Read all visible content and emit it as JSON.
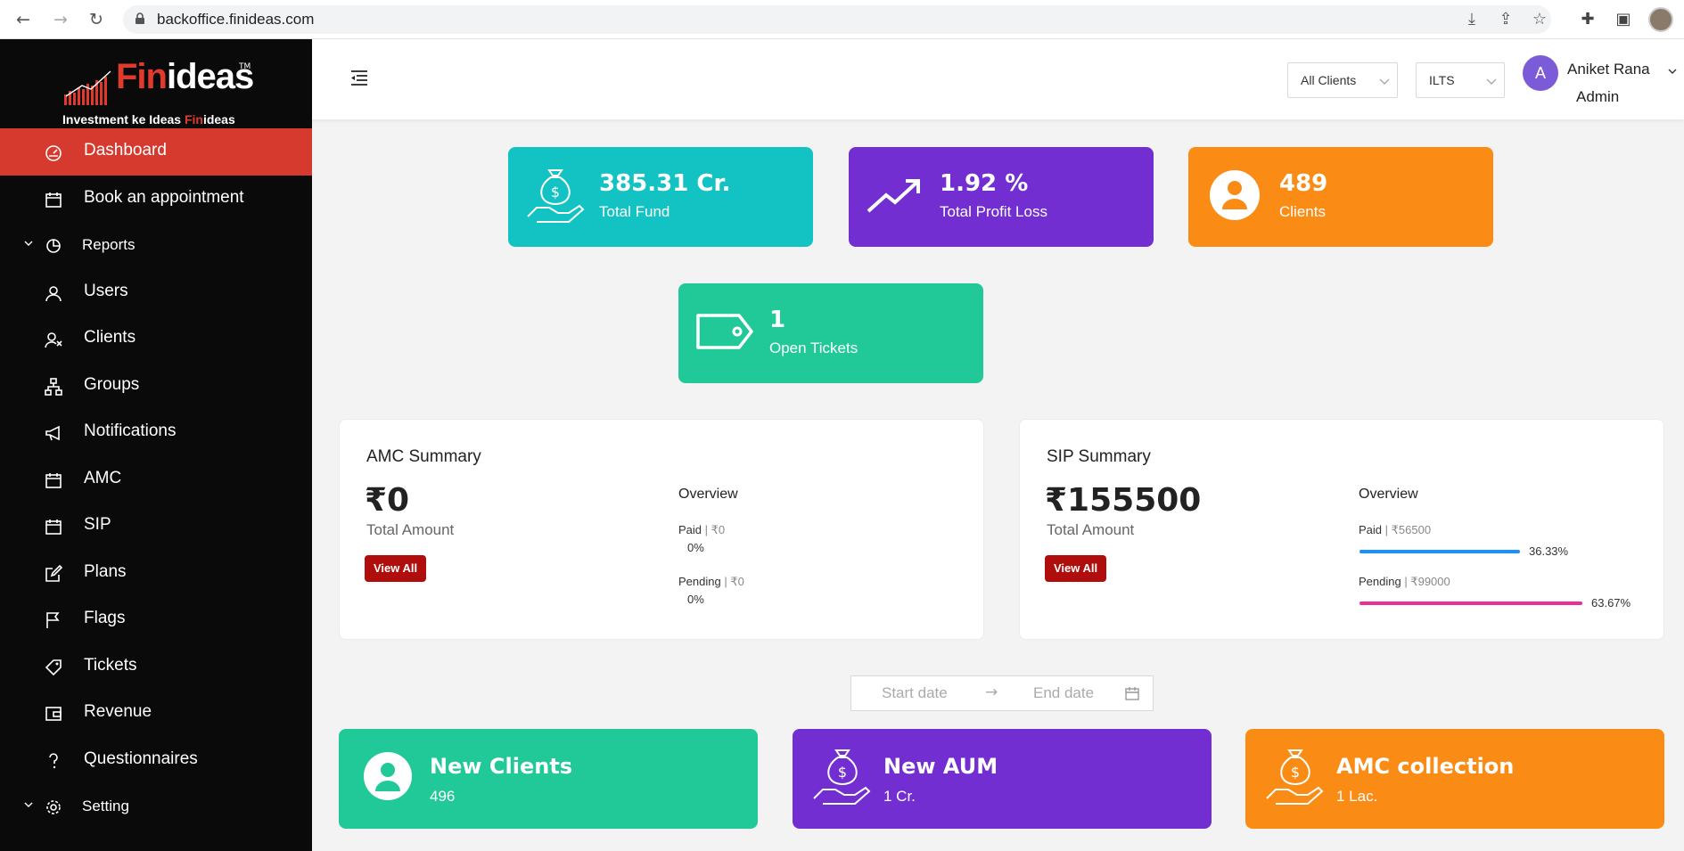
{
  "browser": {
    "url": "backoffice.finideas.com",
    "nav_icons": [
      "back-arrow-icon",
      "forward-arrow-icon",
      "reload-icon"
    ],
    "url_actions": [
      "install-icon",
      "share-icon",
      "star-icon"
    ],
    "extensions": [
      "puzzle-icon",
      "sidepanel-icon",
      "profile-avatar"
    ]
  },
  "sidebar": {
    "logo": {
      "brand_fin": "Fin",
      "brand_ideas": "ideas",
      "tagline_part1": "Investment ke Ideas ",
      "tagline_hl": "Fin",
      "tagline_part2": "ideas",
      "trademark": "TM"
    },
    "items": [
      {
        "label": "Dashboard",
        "icon": "dashboard-icon",
        "active": true
      },
      {
        "label": "Book an appointment",
        "icon": "calendar-icon"
      },
      {
        "label": "Reports",
        "icon": "pie-chart-icon",
        "group": true
      },
      {
        "label": "Users",
        "icon": "user-icon"
      },
      {
        "label": "Clients",
        "icon": "clients-icon"
      },
      {
        "label": "Groups",
        "icon": "groups-icon"
      },
      {
        "label": "Notifications",
        "icon": "megaphone-icon"
      },
      {
        "label": "AMC",
        "icon": "calendar-icon"
      },
      {
        "label": "SIP",
        "icon": "calendar-icon"
      },
      {
        "label": "Plans",
        "icon": "edit-icon"
      },
      {
        "label": "Flags",
        "icon": "flag-icon"
      },
      {
        "label": "Tickets",
        "icon": "tag-icon"
      },
      {
        "label": "Revenue",
        "icon": "wallet-icon"
      },
      {
        "label": "Questionnaires",
        "icon": "question-icon"
      },
      {
        "label": "Setting",
        "icon": "gear-icon",
        "group": true
      }
    ]
  },
  "topbar": {
    "client_filter": "All Clients",
    "company_filter": "ILTS",
    "avatar_letter": "A",
    "user_name": "Aniket Rana",
    "user_role": "Admin"
  },
  "stats": {
    "total_fund": {
      "value": "385.31 Cr.",
      "label": "Total Fund",
      "color": "#13c2c2"
    },
    "profit_loss": {
      "value": "1.92 %",
      "label": "Total Profit Loss",
      "color": "#722ed1"
    },
    "clients": {
      "value": "489",
      "label": "Clients",
      "color": "#fa8c16"
    },
    "tickets": {
      "value": "1",
      "label": "Open Tickets",
      "color": "#20c997"
    }
  },
  "amc_summary": {
    "title": "AMC Summary",
    "amount": "₹0",
    "amount_label": "Total Amount",
    "button": "View All",
    "overview_title": "Overview",
    "paid_label": "Paid",
    "paid_amount": "₹0",
    "paid_pct": "0%",
    "paid_fraction": 0,
    "pending_label": "Pending",
    "pending_amount": "₹0",
    "pending_pct": "0%",
    "pending_fraction": 0
  },
  "sip_summary": {
    "title": "SIP Summary",
    "amount": "₹155500",
    "amount_label": "Total Amount",
    "button": "View All",
    "overview_title": "Overview",
    "paid_label": "Paid",
    "paid_amount": "₹56500",
    "paid_pct": "36.33%",
    "paid_fraction": 0.3633,
    "paid_color": "#1890ff",
    "pending_label": "Pending",
    "pending_amount": "₹99000",
    "pending_pct": "63.67%",
    "pending_fraction": 0.6367,
    "pending_color": "#eb2f96"
  },
  "date_range": {
    "start_placeholder": "Start date",
    "arrow": "→",
    "end_placeholder": "End date"
  },
  "bottom_cards": {
    "new_clients": {
      "title": "New Clients",
      "value": "496",
      "color": "#20c997"
    },
    "new_aum": {
      "title": "New AUM",
      "value": "1 Cr.",
      "color": "#722ed1"
    },
    "amc_collection": {
      "title": "AMC collection",
      "value": "1 Lac.",
      "color": "#fa8c16"
    }
  },
  "brand_colors": {
    "sidebar_bg": "#0a0a0a",
    "active_item": "#d63a2f",
    "button_red": "#b00d0d"
  }
}
